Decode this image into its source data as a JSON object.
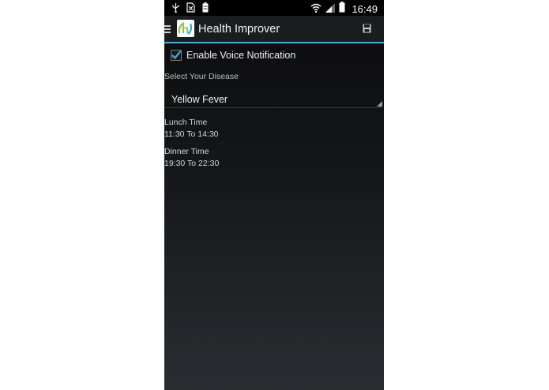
{
  "status_bar": {
    "time": "16:49",
    "icons": [
      "usb-icon",
      "sim-card-icon",
      "battery-icon",
      "wifi-icon",
      "signal-icon",
      "battery-icon"
    ]
  },
  "action_bar": {
    "title": "Health Improver",
    "logo_letter": "h",
    "icons": [
      "drawer-icon",
      "save-icon"
    ]
  },
  "settings": {
    "voice_notification_label": "Enable Voice Notification",
    "voice_notification_checked": true,
    "disease_section_label": "Select Your Disease",
    "selected_disease": "Yellow Fever"
  },
  "schedule": {
    "lunch_label": "Lunch Time",
    "lunch_value": "11:30 To 14:30",
    "dinner_label": "Dinner Time",
    "dinner_value": "19:30 To 22:30"
  },
  "colors": {
    "accent": "#33b5e5",
    "checkbox_check": "#33b5e5",
    "logo_green": "#8dc63f",
    "logo_blue": "#29abe2"
  }
}
